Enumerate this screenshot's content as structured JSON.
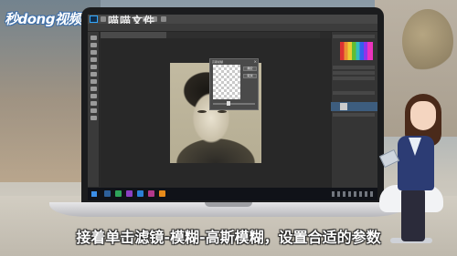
{
  "logo": {
    "text": "秒dong视频"
  },
  "photoshop": {
    "watermark": "喵喵文件",
    "dialog": {
      "title": "高斯模糊",
      "ok_label": "确定",
      "cancel_label": "取消"
    }
  },
  "subtitle": "接着单击滤镜-模糊-高斯模糊，设置合适的参数",
  "colors": {
    "ps_dark": "#2b2b2b",
    "ps_panel": "#353535",
    "taskbar": "#101218",
    "subtitle_text": "#ffffff"
  }
}
